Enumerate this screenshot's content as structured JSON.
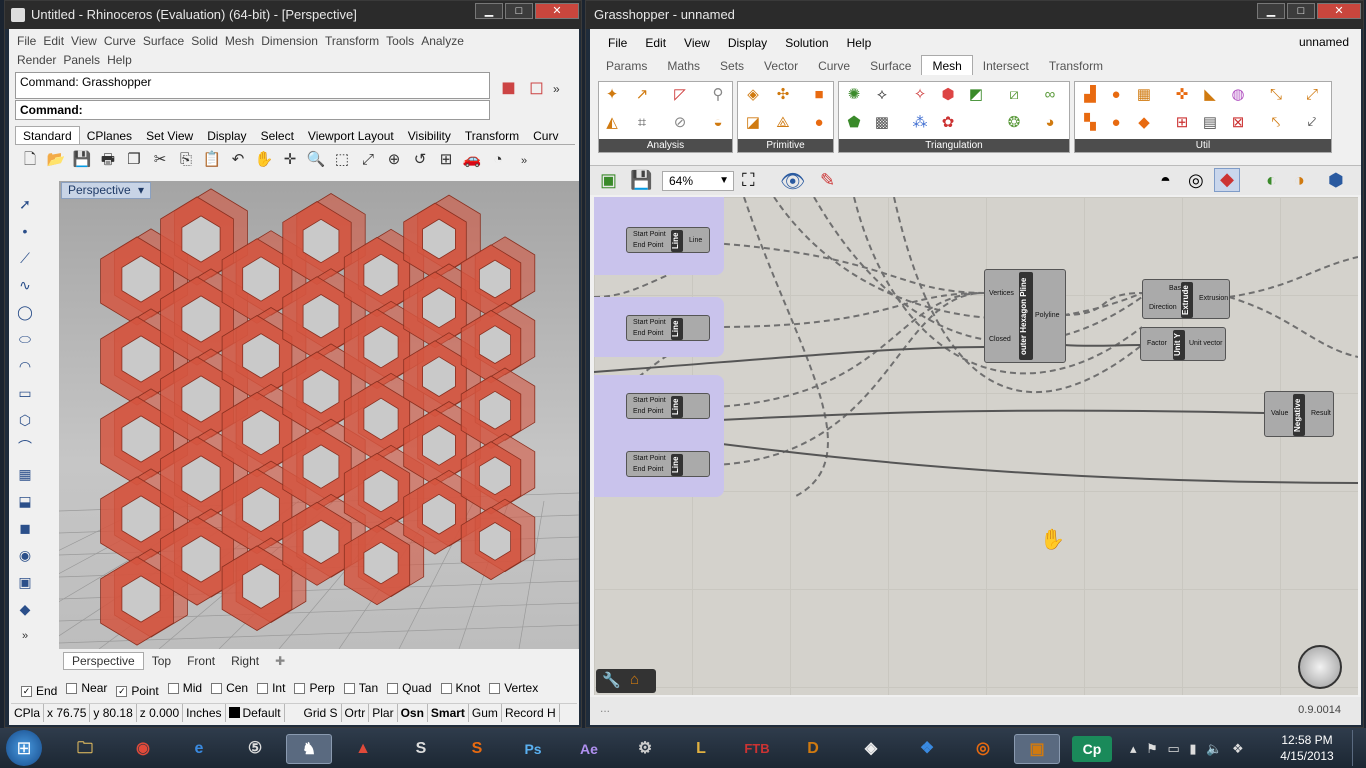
{
  "rhino": {
    "title": "Untitled - Rhinoceros (Evaluation) (64-bit) - [Perspective]",
    "menu1": [
      "File",
      "Edit",
      "View",
      "Curve",
      "Surface",
      "Solid",
      "Mesh",
      "Dimension",
      "Transform",
      "Tools",
      "Analyze"
    ],
    "menu2": [
      "Render",
      "Panels",
      "Help"
    ],
    "command_history": "Command: Grasshopper",
    "command_prompt": "Command:",
    "toolbar_tabs": [
      "Standard",
      "CPlanes",
      "Set View",
      "Display",
      "Select",
      "Viewport Layout",
      "Visibility",
      "Transform",
      "Curv"
    ],
    "viewport_label": "Perspective",
    "view_tabs": [
      "Perspective",
      "Top",
      "Front",
      "Right"
    ],
    "osnaps": [
      {
        "label": "End",
        "checked": true
      },
      {
        "label": "Near",
        "checked": false
      },
      {
        "label": "Point",
        "checked": true
      },
      {
        "label": "Mid",
        "checked": false
      },
      {
        "label": "Cen",
        "checked": false
      },
      {
        "label": "Int",
        "checked": false
      },
      {
        "label": "Perp",
        "checked": false
      },
      {
        "label": "Tan",
        "checked": false
      },
      {
        "label": "Quad",
        "checked": false
      },
      {
        "label": "Knot",
        "checked": false
      },
      {
        "label": "Vertex",
        "checked": false
      }
    ],
    "status": [
      "CPla",
      "x 76.75",
      "y 80.18",
      "z 0.000",
      "Inches",
      "Default",
      "Grid S",
      "Ortr",
      "Plar",
      "Osn",
      "Smart",
      "Gum",
      "Record H"
    ]
  },
  "gh": {
    "title": "Grasshopper - unnamed",
    "menu": [
      "File",
      "Edit",
      "View",
      "Display",
      "Solution",
      "Help"
    ],
    "doc_name": "unnamed",
    "tabs": [
      "Params",
      "Maths",
      "Sets",
      "Vector",
      "Curve",
      "Surface",
      "Mesh",
      "Intersect",
      "Transform"
    ],
    "active_tab": "Mesh",
    "groups": [
      "Analysis",
      "Primitive",
      "Triangulation",
      "Util"
    ],
    "zoom": "64%",
    "version": "0.9.0014",
    "nodes": {
      "line_in1": "Start Point",
      "line_in2": "End Point",
      "line_name": "Line",
      "line_out": "Line",
      "poly_in1": "Vertices",
      "poly_in2": "Closed",
      "poly_name": "outer Hexagon Pline",
      "poly_out": "Polyline",
      "ext_in1": "Base",
      "ext_in2": "Direction",
      "ext_name": "Extrude",
      "ext_out": "Extrusion",
      "unit_in": "Factor",
      "unit_name": "Unit Y",
      "unit_out": "Unit vector",
      "neg_in": "Value",
      "neg_name": "Negative",
      "neg_out": "Result"
    }
  },
  "taskbar": {
    "time": "12:58 PM",
    "date": "4/15/2013"
  },
  "colors": {
    "honeycomb": "#d4553f",
    "gh_canvas": "#d4d2cc",
    "gh_group": "#c9c3ec"
  }
}
